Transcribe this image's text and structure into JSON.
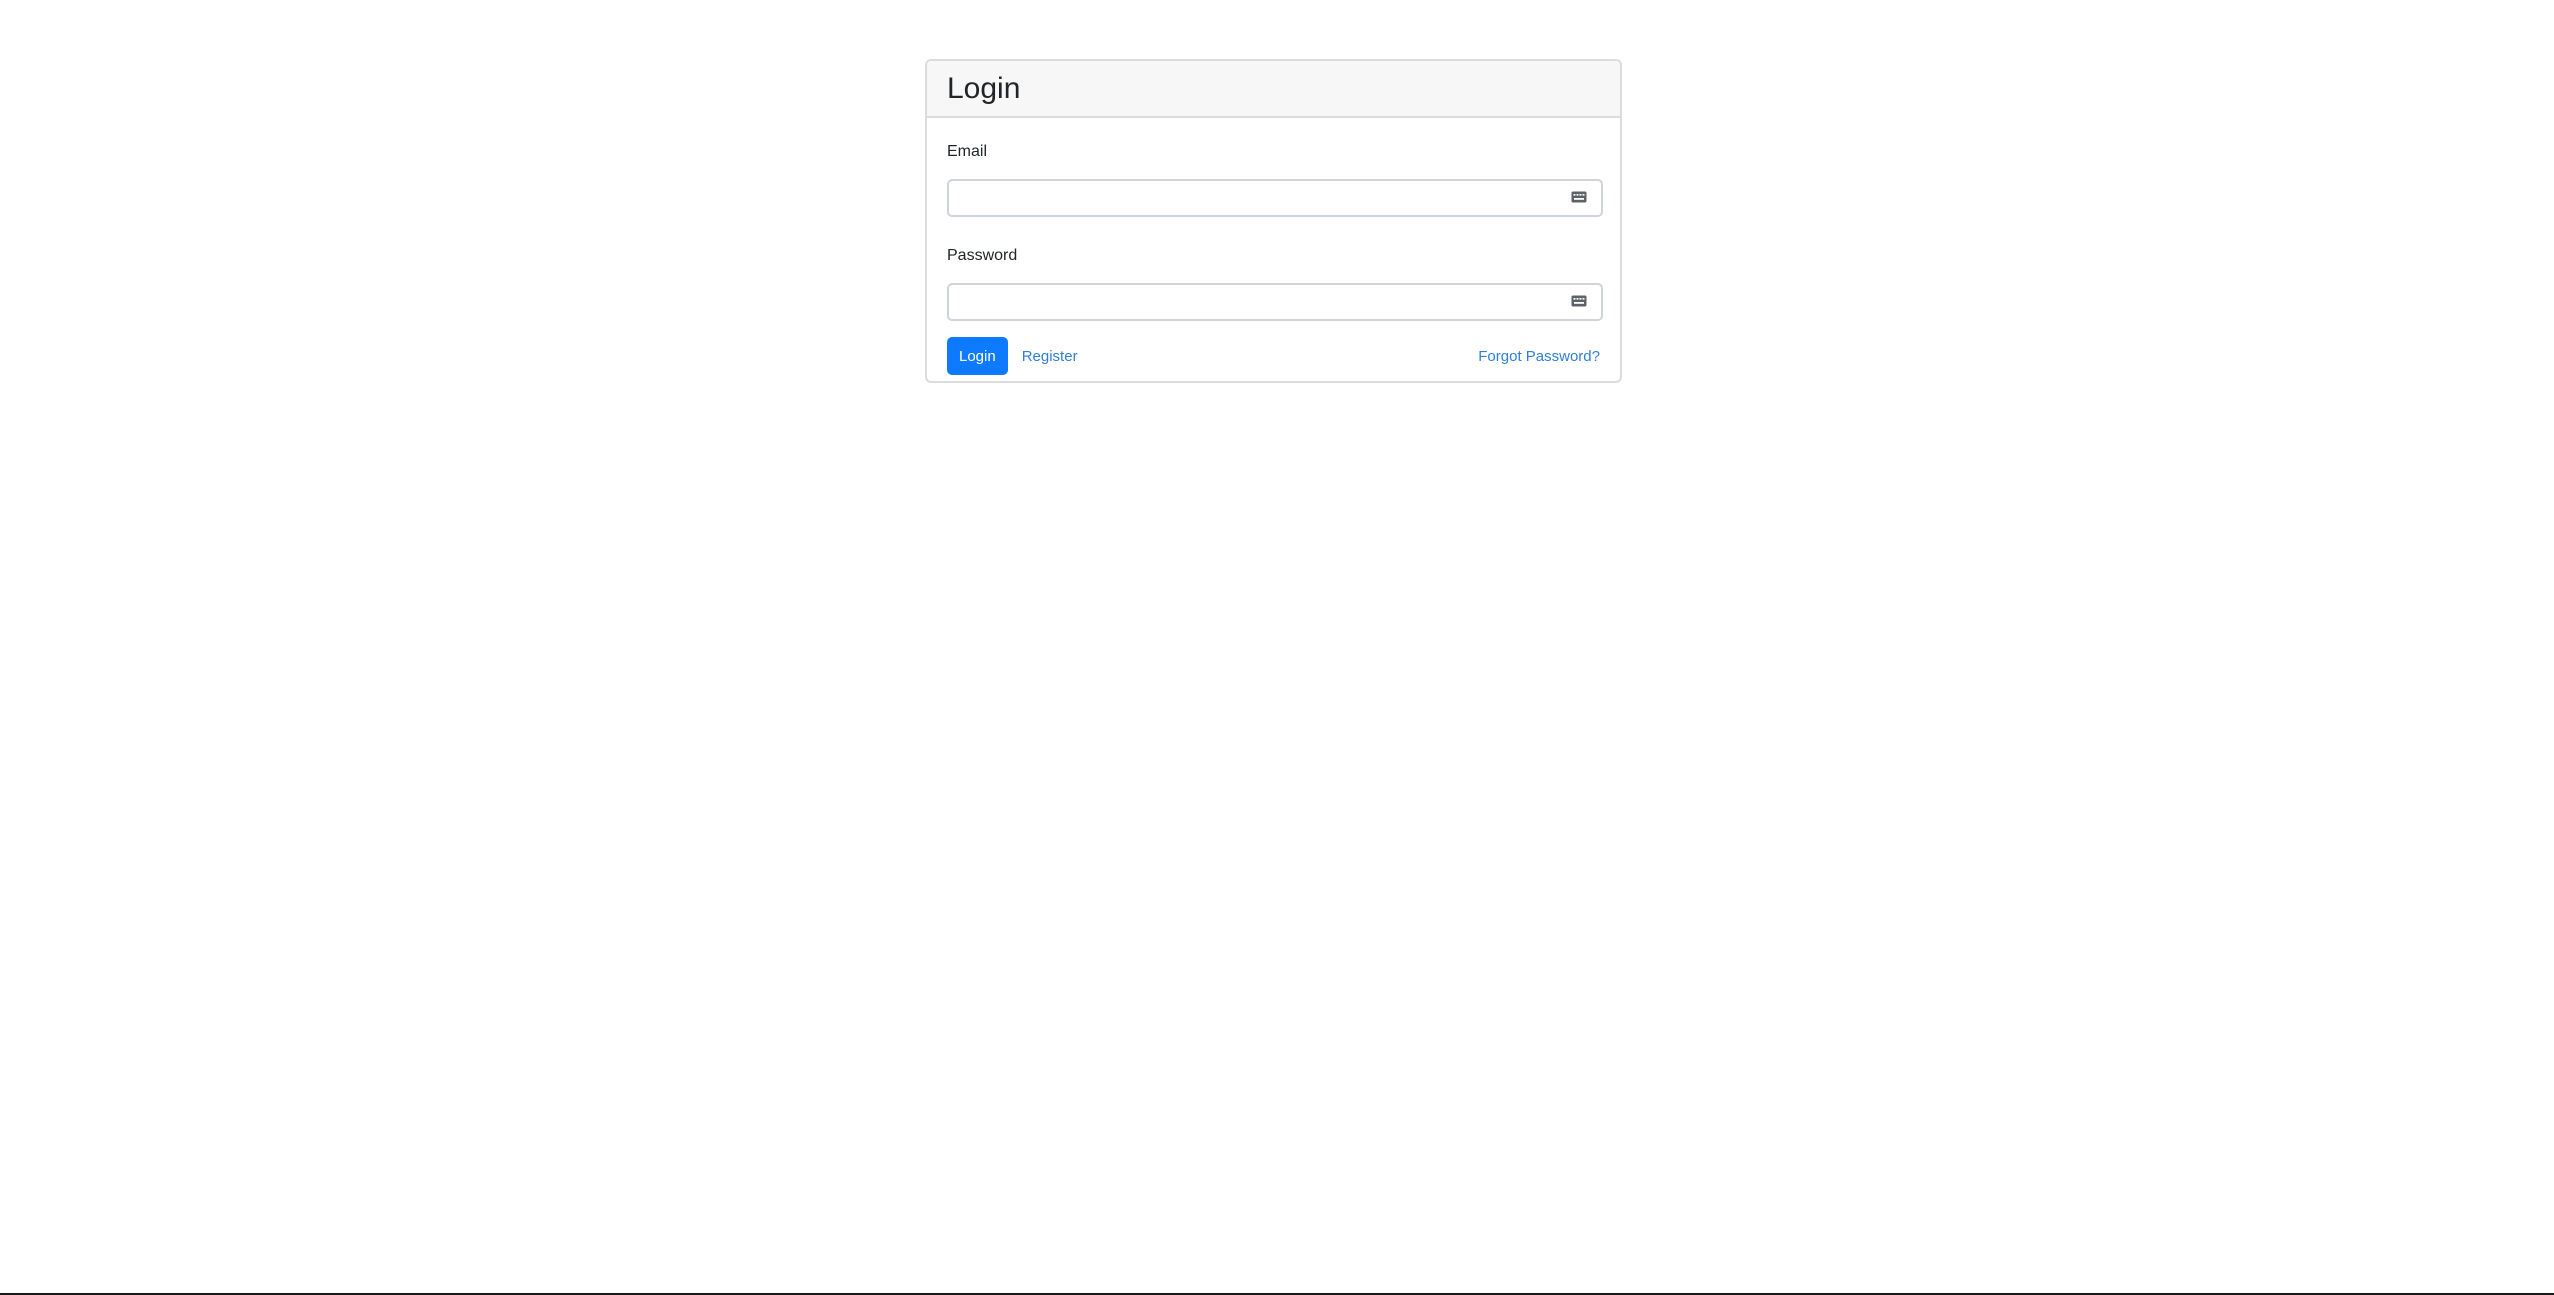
{
  "login_card": {
    "title": "Login",
    "email": {
      "label": "Email",
      "value": "",
      "placeholder": ""
    },
    "password": {
      "label": "Password",
      "value": "",
      "placeholder": ""
    },
    "login_button_label": "Login",
    "register_link_label": "Register",
    "forgot_link_label": "Forgot Password?"
  },
  "icons": {
    "email_field_icon": "password-manager-key-icon",
    "password_field_icon": "password-manager-key-icon"
  },
  "colors": {
    "primary": "#0d7aff",
    "link": "#2f7fd9",
    "header_bg": "#f7f7f7",
    "border": "#dcdcdc"
  }
}
